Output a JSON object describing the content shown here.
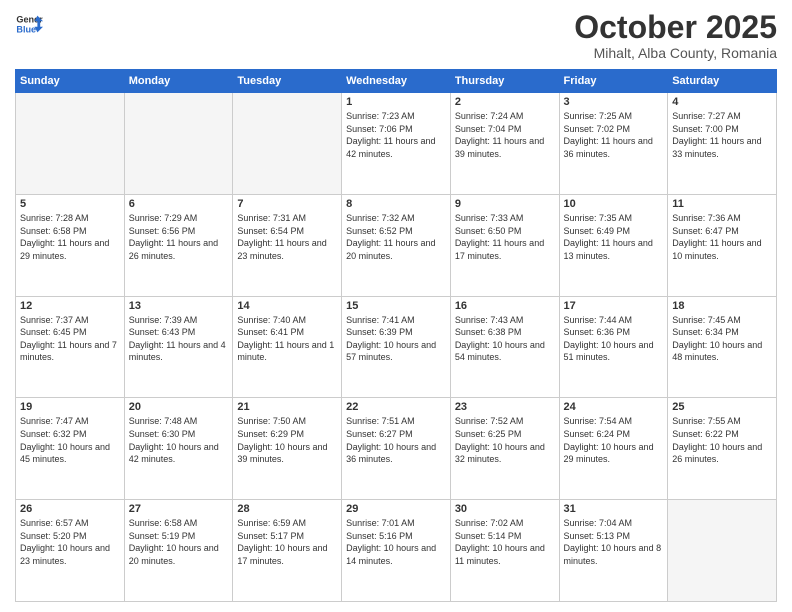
{
  "header": {
    "logo_general": "General",
    "logo_blue": "Blue",
    "month": "October 2025",
    "location": "Mihalt, Alba County, Romania"
  },
  "days_of_week": [
    "Sunday",
    "Monday",
    "Tuesday",
    "Wednesday",
    "Thursday",
    "Friday",
    "Saturday"
  ],
  "weeks": [
    [
      {
        "num": "",
        "info": ""
      },
      {
        "num": "",
        "info": ""
      },
      {
        "num": "",
        "info": ""
      },
      {
        "num": "1",
        "info": "Sunrise: 7:23 AM\nSunset: 7:06 PM\nDaylight: 11 hours and 42 minutes."
      },
      {
        "num": "2",
        "info": "Sunrise: 7:24 AM\nSunset: 7:04 PM\nDaylight: 11 hours and 39 minutes."
      },
      {
        "num": "3",
        "info": "Sunrise: 7:25 AM\nSunset: 7:02 PM\nDaylight: 11 hours and 36 minutes."
      },
      {
        "num": "4",
        "info": "Sunrise: 7:27 AM\nSunset: 7:00 PM\nDaylight: 11 hours and 33 minutes."
      }
    ],
    [
      {
        "num": "5",
        "info": "Sunrise: 7:28 AM\nSunset: 6:58 PM\nDaylight: 11 hours and 29 minutes."
      },
      {
        "num": "6",
        "info": "Sunrise: 7:29 AM\nSunset: 6:56 PM\nDaylight: 11 hours and 26 minutes."
      },
      {
        "num": "7",
        "info": "Sunrise: 7:31 AM\nSunset: 6:54 PM\nDaylight: 11 hours and 23 minutes."
      },
      {
        "num": "8",
        "info": "Sunrise: 7:32 AM\nSunset: 6:52 PM\nDaylight: 11 hours and 20 minutes."
      },
      {
        "num": "9",
        "info": "Sunrise: 7:33 AM\nSunset: 6:50 PM\nDaylight: 11 hours and 17 minutes."
      },
      {
        "num": "10",
        "info": "Sunrise: 7:35 AM\nSunset: 6:49 PM\nDaylight: 11 hours and 13 minutes."
      },
      {
        "num": "11",
        "info": "Sunrise: 7:36 AM\nSunset: 6:47 PM\nDaylight: 11 hours and 10 minutes."
      }
    ],
    [
      {
        "num": "12",
        "info": "Sunrise: 7:37 AM\nSunset: 6:45 PM\nDaylight: 11 hours and 7 minutes."
      },
      {
        "num": "13",
        "info": "Sunrise: 7:39 AM\nSunset: 6:43 PM\nDaylight: 11 hours and 4 minutes."
      },
      {
        "num": "14",
        "info": "Sunrise: 7:40 AM\nSunset: 6:41 PM\nDaylight: 11 hours and 1 minute."
      },
      {
        "num": "15",
        "info": "Sunrise: 7:41 AM\nSunset: 6:39 PM\nDaylight: 10 hours and 57 minutes."
      },
      {
        "num": "16",
        "info": "Sunrise: 7:43 AM\nSunset: 6:38 PM\nDaylight: 10 hours and 54 minutes."
      },
      {
        "num": "17",
        "info": "Sunrise: 7:44 AM\nSunset: 6:36 PM\nDaylight: 10 hours and 51 minutes."
      },
      {
        "num": "18",
        "info": "Sunrise: 7:45 AM\nSunset: 6:34 PM\nDaylight: 10 hours and 48 minutes."
      }
    ],
    [
      {
        "num": "19",
        "info": "Sunrise: 7:47 AM\nSunset: 6:32 PM\nDaylight: 10 hours and 45 minutes."
      },
      {
        "num": "20",
        "info": "Sunrise: 7:48 AM\nSunset: 6:30 PM\nDaylight: 10 hours and 42 minutes."
      },
      {
        "num": "21",
        "info": "Sunrise: 7:50 AM\nSunset: 6:29 PM\nDaylight: 10 hours and 39 minutes."
      },
      {
        "num": "22",
        "info": "Sunrise: 7:51 AM\nSunset: 6:27 PM\nDaylight: 10 hours and 36 minutes."
      },
      {
        "num": "23",
        "info": "Sunrise: 7:52 AM\nSunset: 6:25 PM\nDaylight: 10 hours and 32 minutes."
      },
      {
        "num": "24",
        "info": "Sunrise: 7:54 AM\nSunset: 6:24 PM\nDaylight: 10 hours and 29 minutes."
      },
      {
        "num": "25",
        "info": "Sunrise: 7:55 AM\nSunset: 6:22 PM\nDaylight: 10 hours and 26 minutes."
      }
    ],
    [
      {
        "num": "26",
        "info": "Sunrise: 6:57 AM\nSunset: 5:20 PM\nDaylight: 10 hours and 23 minutes."
      },
      {
        "num": "27",
        "info": "Sunrise: 6:58 AM\nSunset: 5:19 PM\nDaylight: 10 hours and 20 minutes."
      },
      {
        "num": "28",
        "info": "Sunrise: 6:59 AM\nSunset: 5:17 PM\nDaylight: 10 hours and 17 minutes."
      },
      {
        "num": "29",
        "info": "Sunrise: 7:01 AM\nSunset: 5:16 PM\nDaylight: 10 hours and 14 minutes."
      },
      {
        "num": "30",
        "info": "Sunrise: 7:02 AM\nSunset: 5:14 PM\nDaylight: 10 hours and 11 minutes."
      },
      {
        "num": "31",
        "info": "Sunrise: 7:04 AM\nSunset: 5:13 PM\nDaylight: 10 hours and 8 minutes."
      },
      {
        "num": "",
        "info": ""
      }
    ]
  ]
}
